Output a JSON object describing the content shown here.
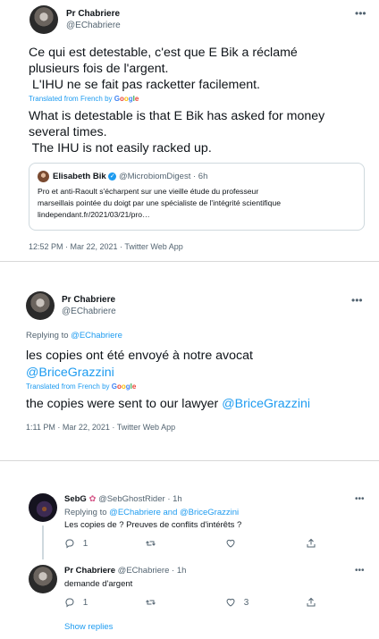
{
  "tweet1": {
    "name": "Pr Chabriere",
    "handle": "@EChabriere",
    "text_line1": "Ce qui est detestable, c'est que E Bik a réclamé",
    "text_line2": "plusieurs fois de l'argent.",
    "text_line3": " L'IHU ne se fait pas racketter facilement.",
    "translated": "Translated from French by",
    "translation_line1": "What is detestable is that E Bik has asked for money",
    "translation_line2": "several times.",
    "translation_line3": " The IHU is not easily racked up.",
    "quote": {
      "name": "Elisabeth Bik",
      "handle": "@MicrobiomDigest",
      "time": "· 6h",
      "line1": "Pro et anti-Raoult s'écharpent sur une vieille étude du professeur",
      "line2": "marseillais pointée du doigt par une spécialiste de l'intégrité scientifique",
      "line3": "lindependant.fr/2021/03/21/pro…"
    },
    "meta": "12:52 PM · Mar 22, 2021 · Twitter Web App"
  },
  "tweet2": {
    "name": "Pr Chabriere",
    "handle": "@EChabriere",
    "replying_prefix": "Replying to",
    "replying_to": "@EChabriere",
    "text_line1": "les copies ont été envoyé à notre avocat",
    "text_mention": "@BriceGrazzini",
    "translated": "Translated from French by",
    "translation_text": "the copies were sent to our lawyer",
    "translation_mention": "@BriceGrazzini",
    "meta": "1:11 PM · Mar 22, 2021 · Twitter Web App"
  },
  "reply1": {
    "name": "SebG",
    "handle": "@SebGhostRider",
    "time": "· 1h",
    "replying_prefix": "Replying to",
    "replying_to": "@EChabriere and @BriceGrazzini",
    "text": "Les copies de ? Preuves de conflits d'intérêts ?",
    "reply_count": "1"
  },
  "reply2": {
    "name": "Pr Chabriere",
    "handle": "@EChabriere",
    "time": "· 1h",
    "text": "demande d'argent",
    "reply_count": "1",
    "like_count": "3"
  },
  "show_replies": "Show replies",
  "google_letters": [
    "G",
    "o",
    "o",
    "g",
    "l",
    "e"
  ],
  "colors": {
    "link": "#1d9bf0",
    "muted": "#536471",
    "border": "#cfd9de"
  }
}
